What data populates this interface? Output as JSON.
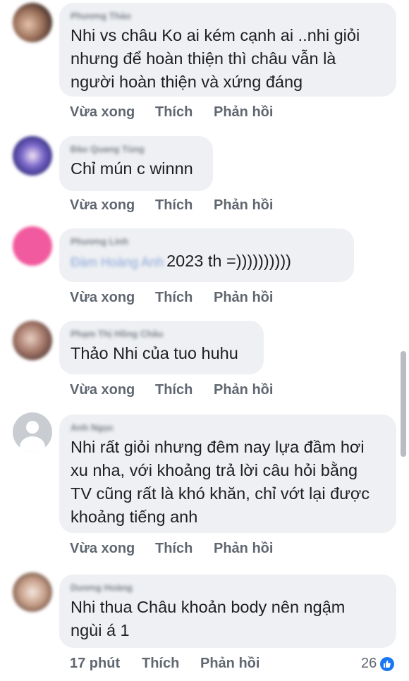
{
  "comments": [
    {
      "author": "Phương Thảo",
      "text": "Nhi vs châu Ko ai kém cạnh ai ..nhi giỏi\nnhưng để hoàn thiện thì châu vẫn là\nngười hoàn thiện và xứng đáng",
      "time": "Vừa xong",
      "like": "Thích",
      "reply": "Phản hồi"
    },
    {
      "author": "Đào Quang Tùng",
      "text": "Chỉ mún c winnn",
      "time": "Vừa xong",
      "like": "Thích",
      "reply": "Phản hồi"
    },
    {
      "author": "Phương Linh",
      "mention": "Đàm Hoàng Anh",
      "text": "2023 th =))))))))))",
      "time": "Vừa xong",
      "like": "Thích",
      "reply": "Phản hồi"
    },
    {
      "author": "Phạm Thị Hồng Châu",
      "text": "Thảo Nhi của tuo huhu",
      "time": "Vừa xong",
      "like": "Thích",
      "reply": "Phản hồi"
    },
    {
      "author": "Anh Ngọc",
      "text": "Nhi rất giỏi nhưng đêm nay lựa đầm hơi\nxu nha, với khoảng trả lời câu hỏi bằng\nTV cũng rất là khó khăn, chỉ vớt lại được\nkhoảng tiếng anh",
      "time": "Vừa xong",
      "like": "Thích",
      "reply": "Phản hồi"
    },
    {
      "author": "Dương Hoàng",
      "text": "Nhi thua Châu khoản body nên ngậm\nngùi á 1",
      "time": "17 phút",
      "like": "Thích",
      "reply": "Phản hồi",
      "reaction_count": "26"
    }
  ],
  "colors": {
    "bubble": "#eef0f3",
    "action_text": "#606770",
    "like_blue": "#1877f2"
  },
  "icons": {
    "reaction": "thumbs-up-icon"
  }
}
